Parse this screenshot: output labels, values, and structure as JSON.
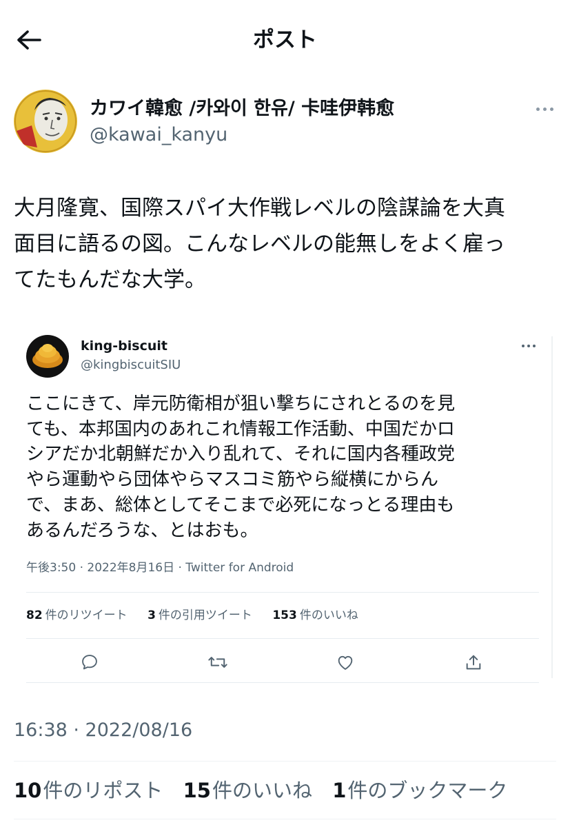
{
  "header": {
    "title": "ポスト",
    "back_icon": "arrow-left-icon"
  },
  "author": {
    "name": "カワイ韓愈 /카와이 한유/ 卡哇伊韩愈",
    "handle": "@kawai_kanyu",
    "avatar_icon": "user-avatar-drawing"
  },
  "post": {
    "lines": [
      "大月隆寛、国際スパイ大作戦レベルの陰謀論を大真",
      "面目に語るの図。こんなレベルの能無しをよく雇っ",
      "てたもんだな大学。"
    ],
    "timestamp": "16:38 · 2022/08/16",
    "stats": [
      {
        "count": "10",
        "label": "件のリポスト"
      },
      {
        "count": "15",
        "label": "件のいいね"
      },
      {
        "count": "1",
        "label": "件のブックマーク"
      }
    ]
  },
  "embedded": {
    "name": "king-biscuit",
    "handle": "@kingbiscuitSIU",
    "lines": [
      "ここにきて、岸元防衛相が狙い撃ちにされとるのを見",
      "ても、本邦国内のあれこれ情報工作活動、中国だかロ",
      "シアだか北朝鮮だか入り乱れて、それに国内各種政党",
      "やら運動やら団体やらマスコミ筋やら縦横にからん",
      "で、まあ、総体としてそこまで必死になっとる理由も",
      "あるんだろうな、とはおも。"
    ],
    "meta": "午後3:50 · 2022年8月16日 · Twitter for Android",
    "stats": [
      {
        "count": "82",
        "label": "件のリツイート"
      },
      {
        "count": "3",
        "label": "件の引用ツイート"
      },
      {
        "count": "153",
        "label": "件のいいね"
      }
    ],
    "actions": [
      "reply-icon",
      "retweet-icon",
      "like-icon",
      "share-icon"
    ]
  },
  "colors": {
    "text": "#0f1419",
    "secondary": "#536471",
    "divider": "#eff3f4"
  }
}
